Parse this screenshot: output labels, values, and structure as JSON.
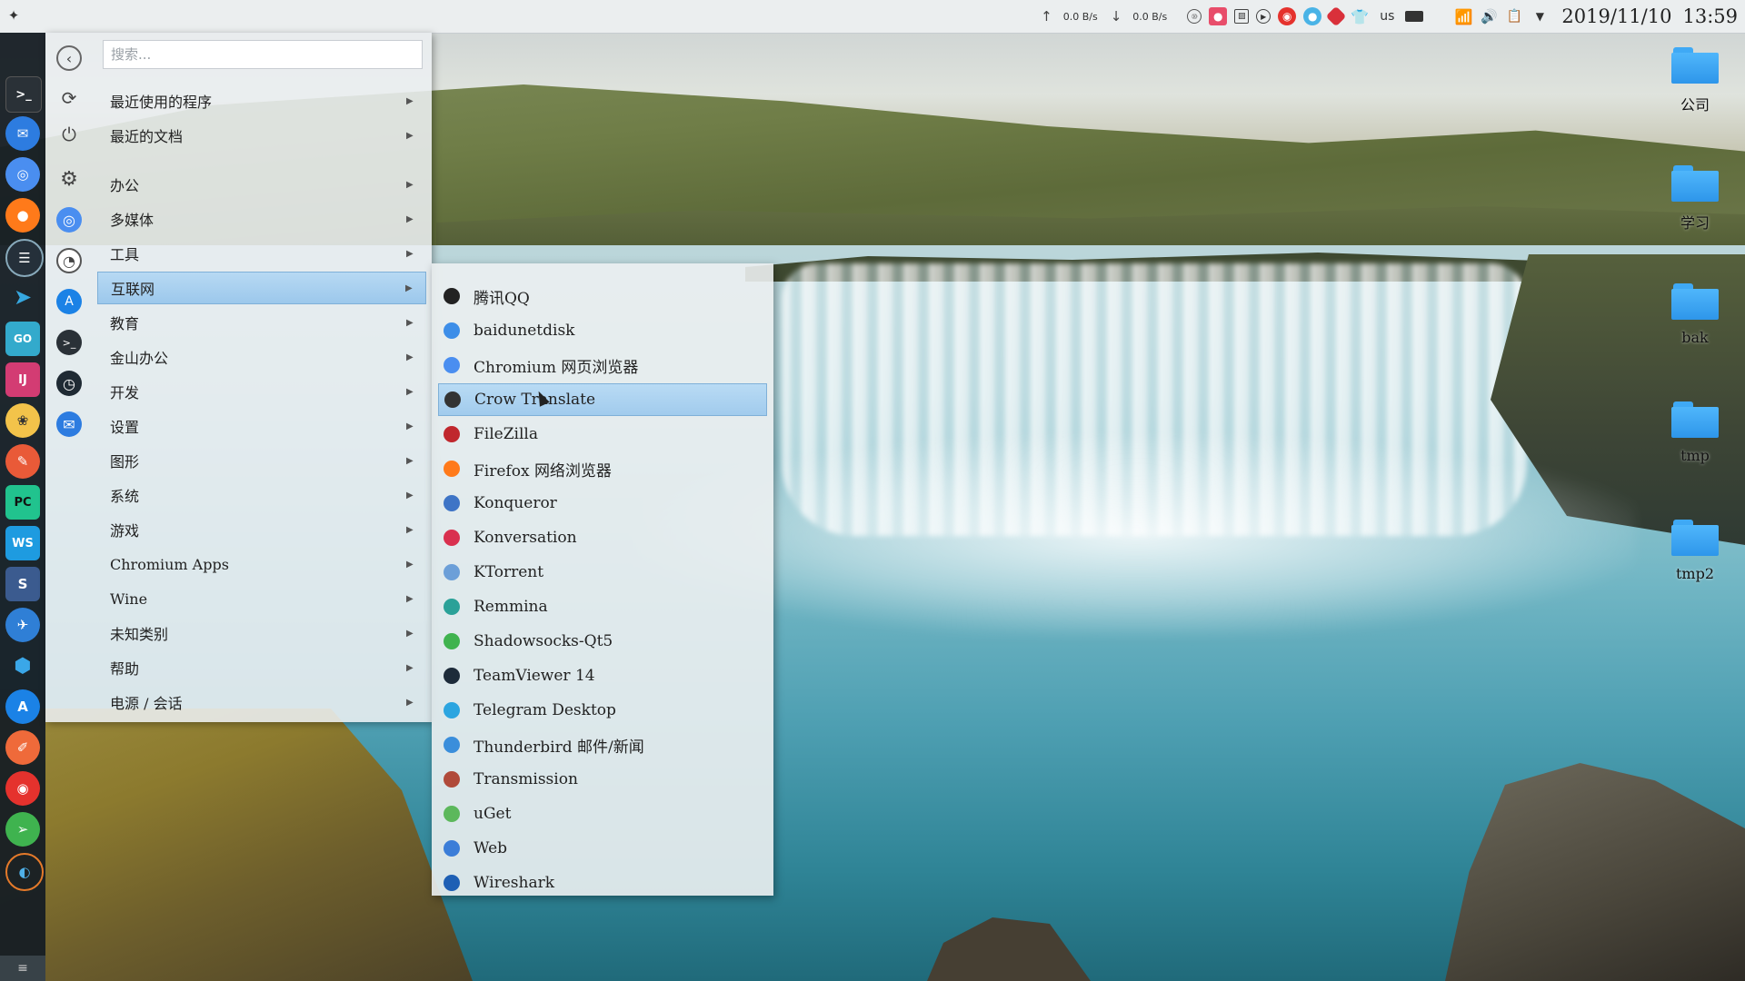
{
  "top_panel": {
    "upload_speed": "0.0 B/s",
    "download_speed": "0.0 B/s",
    "keyboard_layout": "us",
    "date": "2019/11/10",
    "time": "13:59"
  },
  "search": {
    "placeholder": "搜索..."
  },
  "categories": [
    {
      "label": "最近使用的程序"
    },
    {
      "label": "最近的文档"
    },
    {
      "label": "办公"
    },
    {
      "label": "多媒体"
    },
    {
      "label": "工具"
    },
    {
      "label": "互联网"
    },
    {
      "label": "教育"
    },
    {
      "label": "金山办公"
    },
    {
      "label": "开发"
    },
    {
      "label": "设置"
    },
    {
      "label": "图形"
    },
    {
      "label": "系统"
    },
    {
      "label": "游戏"
    },
    {
      "label": "Chromium Apps"
    },
    {
      "label": "Wine"
    },
    {
      "label": "未知类别"
    },
    {
      "label": "帮助"
    },
    {
      "label": "电源 / 会话"
    }
  ],
  "active_category": "互联网",
  "apps": [
    {
      "label": "腾讯QQ",
      "icon": "qq-icon",
      "color": "#222222"
    },
    {
      "label": "baidunetdisk",
      "icon": "baidu-netdisk-icon",
      "color": "#3d8ee8"
    },
    {
      "label": "Chromium 网页浏览器",
      "icon": "chromium-icon",
      "color": "#4a8ef0"
    },
    {
      "label": "Crow Translate",
      "icon": "crow-translate-icon",
      "color": "#333333"
    },
    {
      "label": "FileZilla",
      "icon": "filezilla-icon",
      "color": "#c0272d"
    },
    {
      "label": "Firefox 网络浏览器",
      "icon": "firefox-icon",
      "color": "#ff7a1a"
    },
    {
      "label": "Konqueror",
      "icon": "konqueror-icon",
      "color": "#3e74c6"
    },
    {
      "label": "Konversation",
      "icon": "konversation-icon",
      "color": "#d9304f"
    },
    {
      "label": "KTorrent",
      "icon": "ktorrent-icon",
      "color": "#6c9fd8"
    },
    {
      "label": "Remmina",
      "icon": "remmina-icon",
      "color": "#2aa198"
    },
    {
      "label": "Shadowsocks-Qt5",
      "icon": "shadowsocks-icon",
      "color": "#3fb34f"
    },
    {
      "label": "TeamViewer 14",
      "icon": "teamviewer-icon",
      "color": "#1d2b3a"
    },
    {
      "label": "Telegram Desktop",
      "icon": "telegram-icon",
      "color": "#2ca5e0"
    },
    {
      "label": "Thunderbird 邮件/新闻",
      "icon": "thunderbird-icon",
      "color": "#3a8edb"
    },
    {
      "label": "Transmission",
      "icon": "transmission-icon",
      "color": "#b04a3a"
    },
    {
      "label": "uGet",
      "icon": "uget-icon",
      "color": "#5cb85c"
    },
    {
      "label": "Web",
      "icon": "web-icon",
      "color": "#3b7dd8"
    },
    {
      "label": "Wireshark",
      "icon": "wireshark-icon",
      "color": "#1e5fb4"
    }
  ],
  "active_app": "Crow Translate",
  "desktop_icons": [
    {
      "label": "公司"
    },
    {
      "label": "学习"
    },
    {
      "label": "bak"
    },
    {
      "label": "tmp"
    },
    {
      "label": "tmp2"
    }
  ]
}
